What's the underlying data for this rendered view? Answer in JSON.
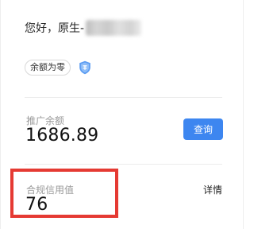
{
  "account": {
    "greeting": "您好，原生-",
    "badge_label": "余额为零",
    "badge_icon": "shield-icon"
  },
  "promotion": {
    "label": "推广余额",
    "value": "1686.89",
    "query_button": "查询"
  },
  "compliance": {
    "label": "合规信用值",
    "value": "76",
    "detail_link": "详情"
  },
  "colors": {
    "primary_button": "#3d86f0",
    "highlight_border": "#e53a33",
    "shield": "#5b9cf2"
  }
}
